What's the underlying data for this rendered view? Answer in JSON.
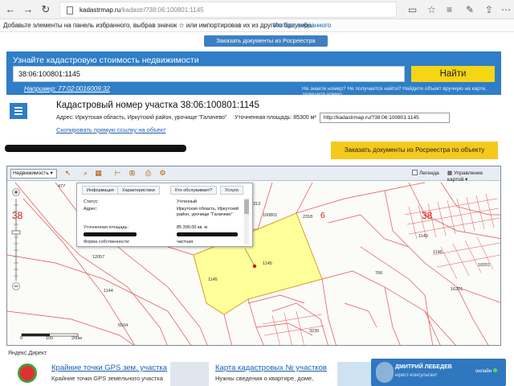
{
  "browser": {
    "url_host": "kadastrmap.ru",
    "url_path": "/kadastr/?38:06:100801:1145",
    "favorites_message": "Добавьте элементы на панель избранного, выбрав значок ☆ или импортировав их из другого браузера.",
    "favorites_link": "Импорт избранного"
  },
  "top_button": "Заказать документы из Росреестра",
  "search": {
    "title": "Узнайте кадастровую стоимость недвижимости",
    "value": "38:06:100801:1145",
    "button": "Найти",
    "example": "Например: 77:02:0016009:32",
    "hint": "Не знаете номер? Не получается найти? Найдите объект вручную на карте, запишите номер"
  },
  "parcel": {
    "title": "Кадастровый номер участка 38:06:100801:1145",
    "address": "Адрес: Иркутская область, Иркутский район, урочище \"Галачево\"",
    "area": "Уточненная площадь: 85300 м²",
    "url": "http://kadastrmap.ru/?38:06:100801:1145",
    "copy_link": "Скопировать прямую ссылку на объект",
    "order_button": "Заказать документы из Росреестра по объекту"
  },
  "map": {
    "layer_select": "Недвижимость",
    "legend_label": "Легенда",
    "control_label": "Управление картой",
    "scale_labels": [
      "0",
      "100",
      "200м"
    ],
    "parcel_labels": [
      "477",
      "1145",
      "12057",
      "1144",
      "6504",
      "100801",
      "2318",
      "1145",
      "1145",
      "766",
      "16201",
      "3235",
      "313",
      "1143",
      "18201"
    ],
    "big_labels": [
      "38",
      "38",
      "6"
    ],
    "popup": {
      "tabs": [
        "Информация",
        "Характеристики",
        "Кто обслуживает?",
        "Услуги"
      ],
      "rows": [
        {
          "label": "Статус:",
          "value": "Учтенный"
        },
        {
          "label": "Адрес:",
          "value": "Иркутская область, Иркутский район, урочище \"Галачево\""
        },
        {
          "label": "Уточненная площадь:",
          "value": "85 300.00 кв. м"
        },
        {
          "label": "Форма собственности:",
          "value": "частная"
        }
      ]
    }
  },
  "ads": {
    "label": "Яндекс.Директ",
    "ad1_title": "Крайние точки GPS зем. участка",
    "ad1_desc": "Крайние точки GPS земельного участка",
    "ad2_title": "Карта кадастровых № участков",
    "ad2_desc": "Нужны сведения о квартире, доме,"
  },
  "chat": {
    "name": "ДМИТРИЙ ЛЕБЕДЕВ",
    "role": "юрист-консультант",
    "status": "онлайн"
  },
  "colors": {
    "accent_blue": "#2f7ec7",
    "button_yellow": "#f5d514",
    "parcel_fill": "#ffff99",
    "map_label_red": "#d11111"
  }
}
